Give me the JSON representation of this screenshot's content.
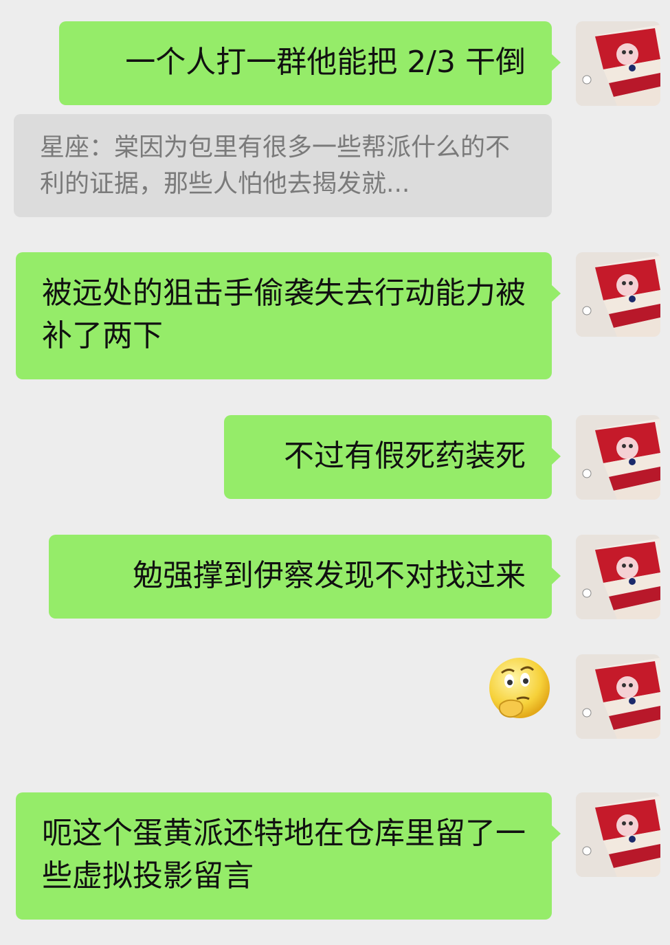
{
  "messages": [
    {
      "text": "一个人打一群他能把 2/3 干倒"
    },
    {
      "quote_sender": "星座：",
      "quote_text": "棠因为包里有很多一些帮派什么的不利的证据，那些人怕他去揭发就..."
    },
    {
      "text": "被远处的狙击手偷袭失去行动能力被补了两下"
    },
    {
      "text": "不过有假死药装死"
    },
    {
      "text": "勉强撑到伊察发现不对找过来"
    },
    {
      "emoji": "thinking-face"
    },
    {
      "text": "呃这个蛋黄派还特地在仓库里留了一些虚拟投影留言"
    }
  ],
  "colors": {
    "background": "#ededed",
    "outgoing_bubble": "#95ec69",
    "quote_bg": "#dcdcdc",
    "quote_text": "#7a7a7a"
  },
  "avatar": {
    "icon": "red-velvet-cake-avatar-icon"
  }
}
